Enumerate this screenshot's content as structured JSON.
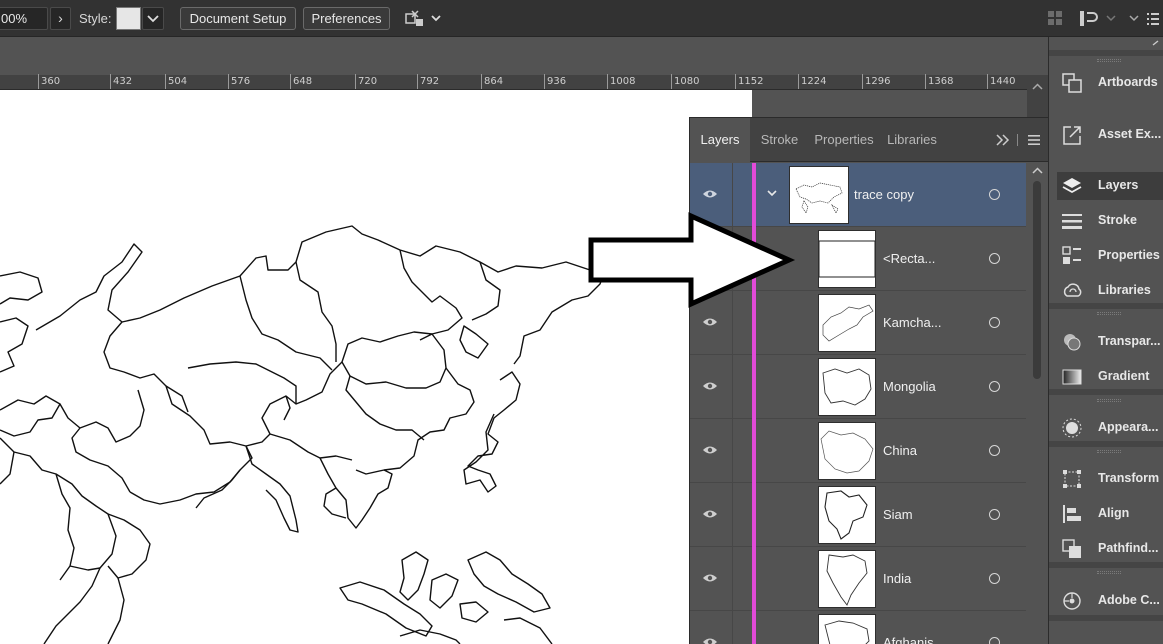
{
  "control_bar": {
    "zoom_value": "00%",
    "style_label": "Style:",
    "document_setup_label": "Document Setup",
    "preferences_label": "Preferences"
  },
  "ruler": {
    "ticks": [
      "360",
      "432",
      "504",
      "576",
      "648",
      "720",
      "792",
      "864",
      "936",
      "1008",
      "1080",
      "1152",
      "1224",
      "1296",
      "1368",
      "1440"
    ]
  },
  "layers_panel": {
    "tabs": [
      "Layers",
      "Stroke",
      "Properties",
      "Libraries"
    ],
    "active_tab": "Layers",
    "layers": [
      {
        "name": "trace copy",
        "selected": true,
        "visible": true,
        "expandable": true
      },
      {
        "name": "<Recta...",
        "selected": false,
        "visible": false
      },
      {
        "name": "Kamcha...",
        "selected": false,
        "visible": true
      },
      {
        "name": "Mongolia",
        "selected": false,
        "visible": true
      },
      {
        "name": "China",
        "selected": false,
        "visible": true
      },
      {
        "name": "Siam",
        "selected": false,
        "visible": true
      },
      {
        "name": "India",
        "selected": false,
        "visible": true
      },
      {
        "name": "Afghanis...",
        "selected": false,
        "visible": true
      }
    ],
    "layer_color": "#e24bd8",
    "selection_color": "#4b5e7b"
  },
  "dock": {
    "items": [
      {
        "label": "Artboards",
        "icon": "artboards-icon"
      },
      {
        "label": "Asset Ex...",
        "icon": "asset-export-icon"
      },
      {
        "label": "Layers",
        "icon": "layers-icon",
        "active": true
      },
      {
        "label": "Stroke",
        "icon": "stroke-icon"
      },
      {
        "label": "Properties",
        "icon": "properties-icon"
      },
      {
        "label": "Libraries",
        "icon": "libraries-icon"
      },
      {
        "label": "Transpar...",
        "icon": "transparency-icon"
      },
      {
        "label": "Gradient",
        "icon": "gradient-icon"
      },
      {
        "label": "Appeara...",
        "icon": "appearance-icon"
      },
      {
        "label": "Transform",
        "icon": "transform-icon"
      },
      {
        "label": "Align",
        "icon": "align-icon"
      },
      {
        "label": "Pathfind...",
        "icon": "pathfinder-icon"
      },
      {
        "label": "Adobe C...",
        "icon": "adobe-capture-icon"
      }
    ]
  }
}
